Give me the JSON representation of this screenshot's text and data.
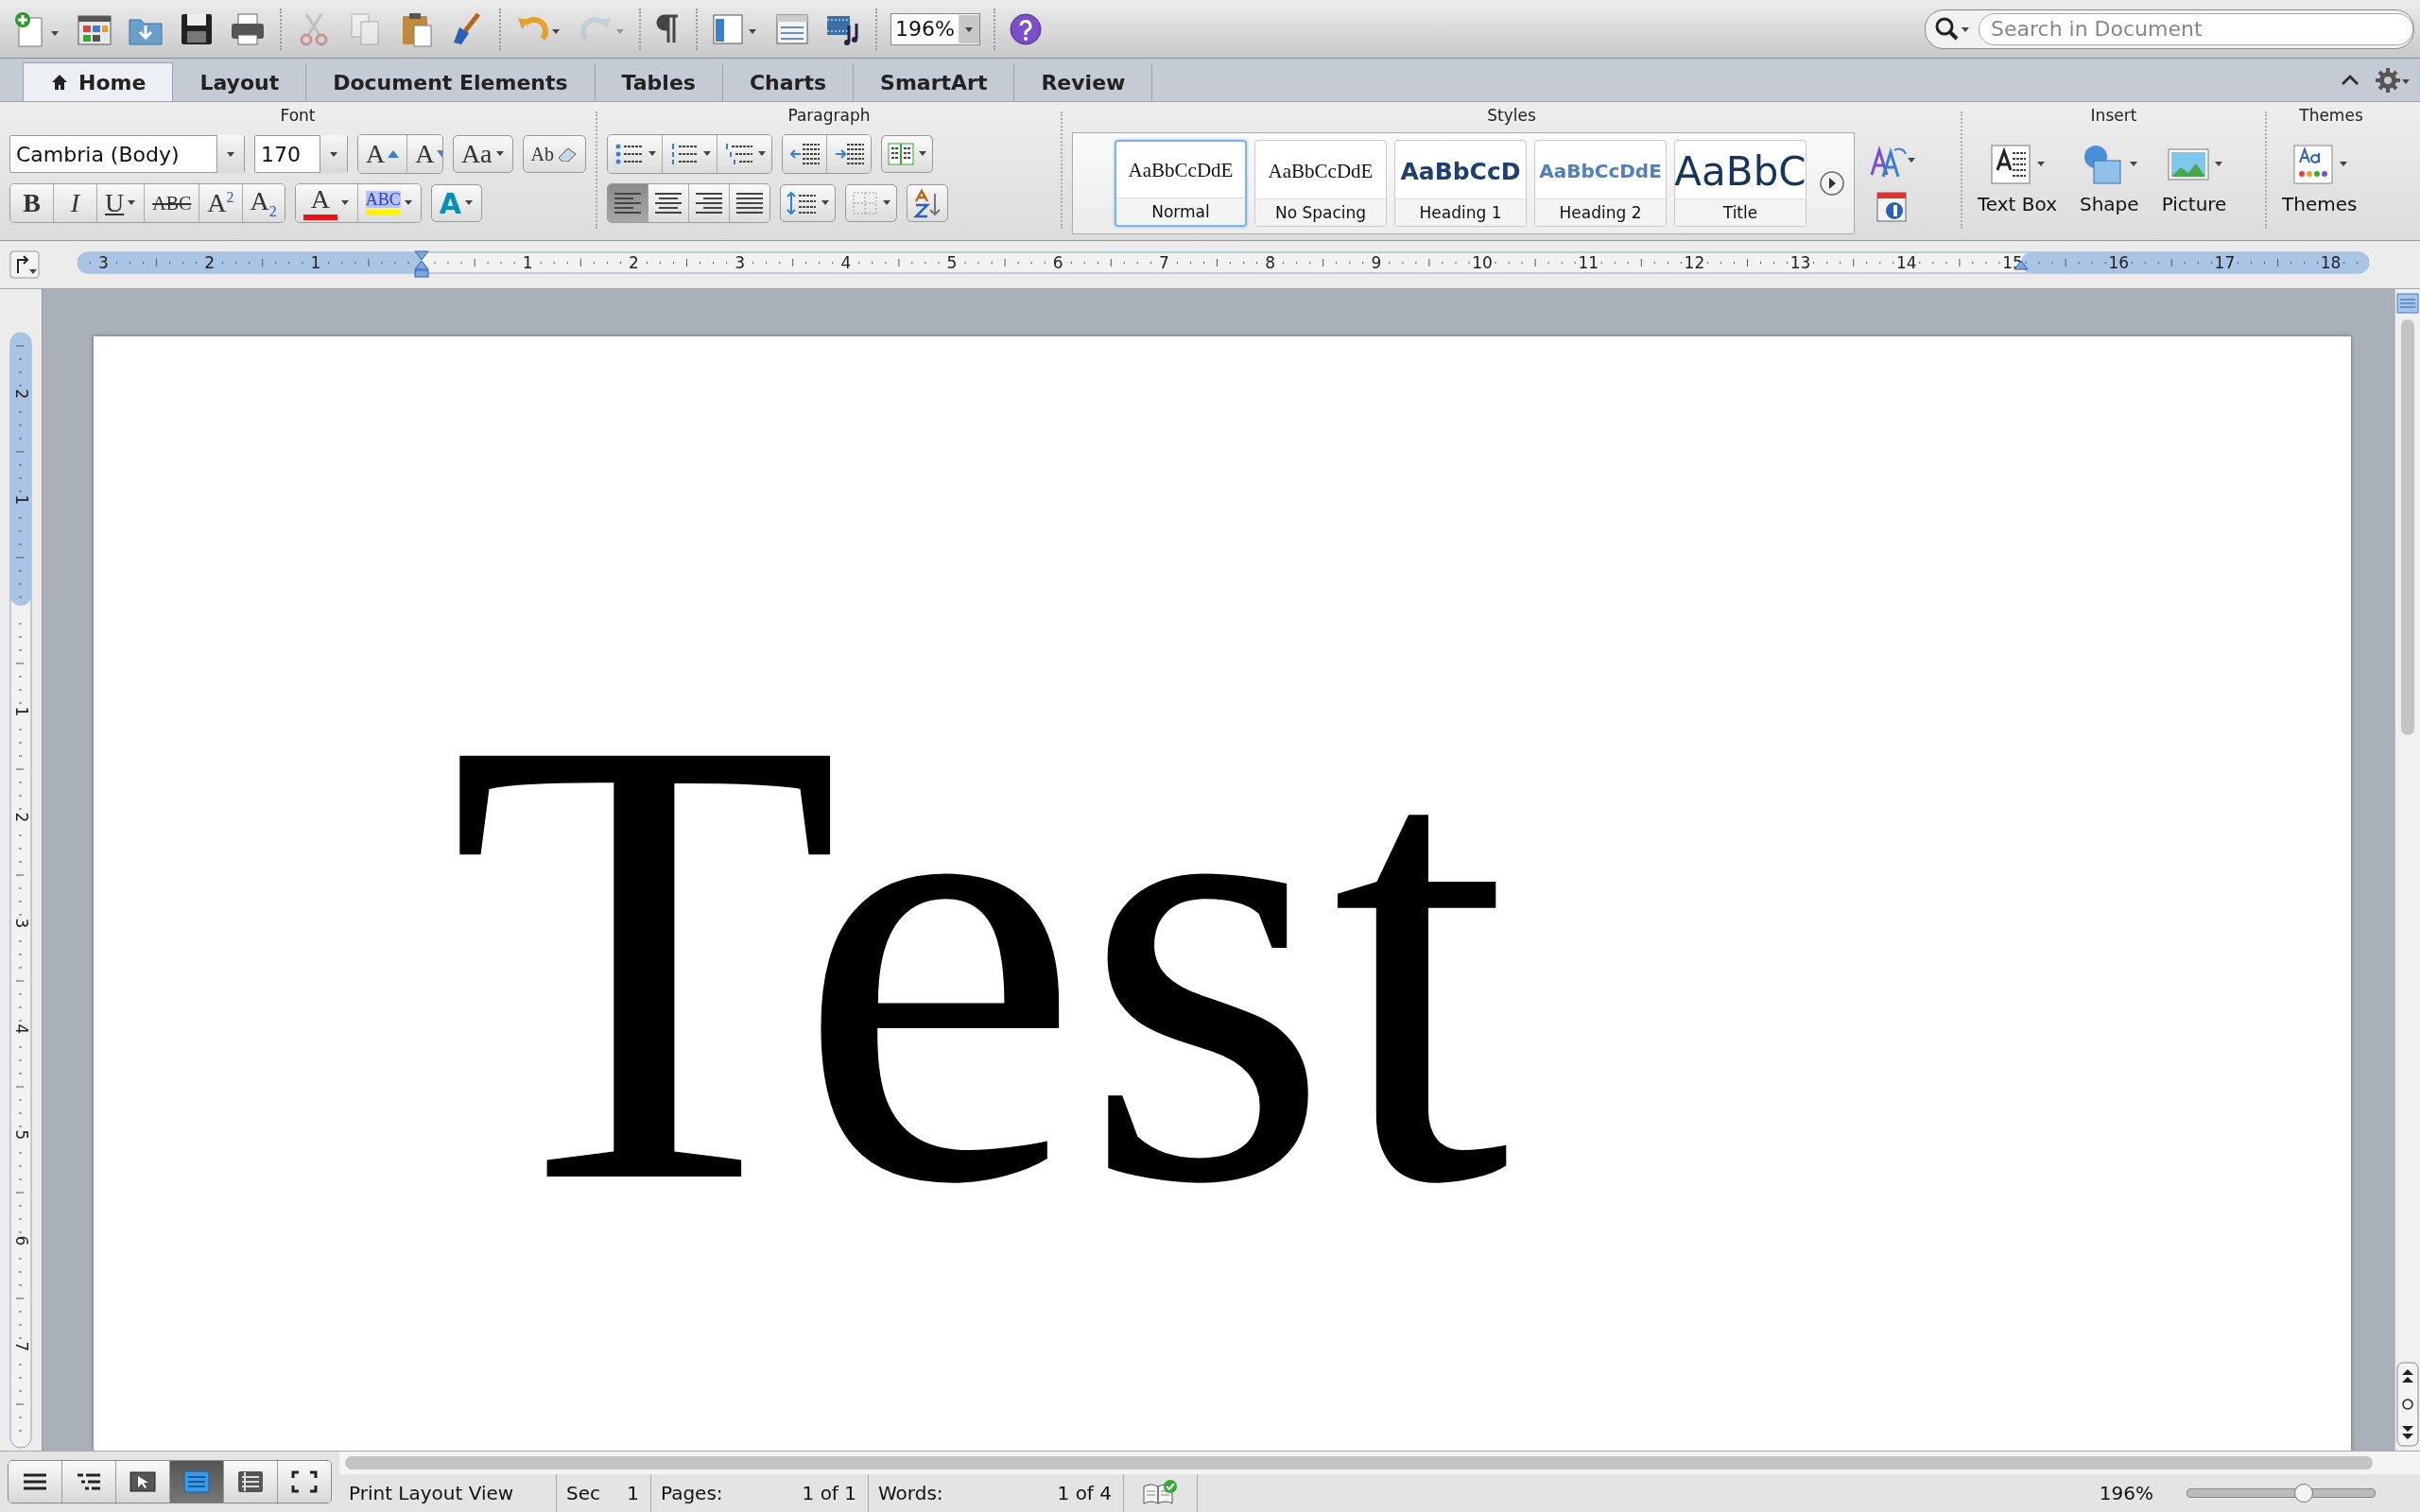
{
  "toolbar": {
    "tools": [
      {
        "kind": "new",
        "disabled": false
      },
      {
        "kind": "gallery",
        "disabled": false
      },
      {
        "kind": "open",
        "disabled": false
      },
      {
        "kind": "save",
        "disabled": false
      },
      {
        "kind": "print",
        "disabled": false
      },
      {
        "kind": "cut",
        "disabled": true
      },
      {
        "kind": "copy",
        "disabled": true
      },
      {
        "kind": "paste",
        "disabled": false
      },
      {
        "kind": "painter",
        "disabled": false
      },
      {
        "kind": "undo",
        "disabled": false
      },
      {
        "kind": "redo",
        "disabled": true
      },
      {
        "kind": "pilcrow",
        "disabled": false
      },
      {
        "kind": "sidebar",
        "disabled": false
      },
      {
        "kind": "toolbox",
        "disabled": false
      },
      {
        "kind": "media",
        "disabled": false
      }
    ],
    "zoom": "196%",
    "search": {
      "placeholder": "Search in Document"
    }
  },
  "tabs": [
    {
      "label": "Home",
      "selected": true
    },
    {
      "label": "Layout",
      "selected": false
    },
    {
      "label": "Document Elements",
      "selected": false
    },
    {
      "label": "Tables",
      "selected": false
    },
    {
      "label": "Charts",
      "selected": false
    },
    {
      "label": "SmartArt",
      "selected": false
    },
    {
      "label": "Review",
      "selected": false
    }
  ],
  "font": {
    "title": "Font",
    "name": "Cambria (Body)",
    "size": "170",
    "tools": [
      {
        "kind": "grow",
        "label": "A"
      },
      {
        "kind": "shrink",
        "label": "A"
      },
      {
        "kind": "case",
        "label": "Aa"
      },
      {
        "kind": "clear",
        "label": "Ab"
      }
    ],
    "format": [
      {
        "kind": "bold",
        "label": "B"
      },
      {
        "kind": "italic",
        "label": "I"
      },
      {
        "kind": "underline",
        "label": "U"
      },
      {
        "kind": "strike",
        "label": "ABC"
      },
      {
        "kind": "super",
        "label": "A$^{2}$"
      },
      {
        "kind": "sub",
        "label": "A$_{2}$"
      },
      {
        "kind": "color",
        "label": "A",
        "color": "#e8141b"
      },
      {
        "kind": "highlight",
        "label": "ABC",
        "color": "#fff200"
      },
      {
        "kind": "effects",
        "label": "A"
      }
    ]
  },
  "paragraph": {
    "title": "Paragraph",
    "alignment": [
      {
        "selected": true
      },
      {
        "selected": false
      },
      {
        "selected": false
      },
      {
        "selected": false
      }
    ]
  },
  "styles": {
    "title": "Styles",
    "items": [
      {
        "kind": "normal",
        "preview": "AaBbCcDdE",
        "label": "Normal",
        "selected": true
      },
      {
        "kind": "plain",
        "preview": "AaBbCcDdE",
        "label": "No Spacing",
        "selected": false
      },
      {
        "kind": "heading1",
        "preview": "AaBbCcD",
        "label": "Heading 1",
        "selected": false
      },
      {
        "kind": "heading2",
        "preview": "AaBbCcDdE",
        "label": "Heading 2",
        "selected": false
      },
      {
        "kind": "title",
        "preview": "AaBbC",
        "label": "Title",
        "selected": false
      }
    ]
  },
  "insert": {
    "title": "Insert",
    "items": [
      {
        "kind": "textbox",
        "label": "Text Box"
      },
      {
        "kind": "shape",
        "label": "Shape"
      },
      {
        "kind": "picture",
        "label": "Picture"
      }
    ]
  },
  "themes": {
    "title": "Themes",
    "label": "Themes"
  },
  "ruler": {
    "labels": [
      "3",
      "2",
      "1",
      "1",
      "2",
      "3",
      "4",
      "5",
      "6",
      "7",
      "8",
      "9",
      "10",
      "11",
      "12",
      "13",
      "14",
      "15",
      "16",
      "17",
      "18"
    ]
  },
  "vertical_ruler": {
    "labels": [
      "2",
      "1",
      "1",
      "2",
      "3",
      "4",
      "5",
      "6",
      "7"
    ]
  },
  "document": {
    "text": "Test"
  },
  "views": [
    {
      "selected": false
    },
    {
      "selected": false
    },
    {
      "selected": false
    },
    {
      "selected": true
    },
    {
      "selected": false
    },
    {
      "selected": false
    }
  ],
  "status_bar": {
    "view": "Print Layout View",
    "section_label": "Sec",
    "section": "1",
    "pages_label": "Pages:",
    "pages": "1 of 1",
    "words_label": "Words:",
    "words": "1 of 4",
    "zoom": "196%",
    "zoom_level": {
      "level": 0.62
    }
  }
}
